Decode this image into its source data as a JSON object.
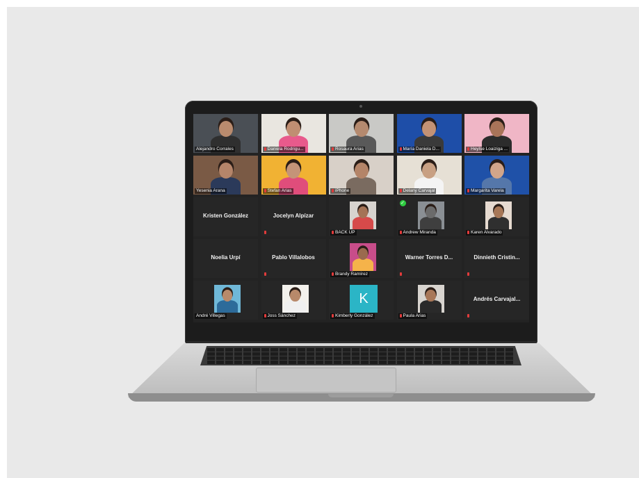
{
  "meeting": {
    "participants": [
      {
        "name": "Alejandro Corrales",
        "type": "video",
        "photo_bg": "#4a4f55",
        "skin": "#b98b6e",
        "clothes": "#2f2f2f",
        "muted": false
      },
      {
        "name": "Daniela Rodrigu...",
        "type": "video",
        "photo_bg": "#e9e6e0",
        "skin": "#c08e72",
        "clothes": "#e85a8c",
        "muted": true
      },
      {
        "name": "Rosaura Arias",
        "type": "video",
        "photo_bg": "#c9c9c6",
        "skin": "#b58a6f",
        "clothes": "#595959",
        "muted": true
      },
      {
        "name": "María Daniela D...",
        "type": "video",
        "photo_bg": "#1e4ea8",
        "skin": "#c39275",
        "clothes": "#3a3a3a",
        "muted": true
      },
      {
        "name": "Heylse Loaiziga ...",
        "type": "video",
        "photo_bg": "#f0b6c6",
        "skin": "#a97459",
        "clothes": "#2c2c2c",
        "muted": true
      },
      {
        "name": "Yesenia Arana",
        "type": "video",
        "photo_bg": "#7a5a45",
        "skin": "#b5856a",
        "clothes": "#2b3a5a",
        "muted": false
      },
      {
        "name": "Stefan Arias",
        "type": "video",
        "photo_bg": "#f1b233",
        "skin": "#c49478",
        "clothes": "#e04d7b",
        "muted": true
      },
      {
        "name": "iPhone",
        "type": "video",
        "photo_bg": "#d8d0c8",
        "skin": "#b48468",
        "clothes": "#7a6b60",
        "muted": true
      },
      {
        "name": "Delany Carvajal",
        "type": "video",
        "photo_bg": "#e6e0d5",
        "skin": "#c8a083",
        "clothes": "#f4f4f4",
        "muted": true
      },
      {
        "name": "Margarita Varela",
        "type": "video",
        "photo_bg": "#1f51a8",
        "skin": "#d1a58a",
        "clothes": "#5577aa",
        "muted": true
      },
      {
        "name": "Kristen González",
        "type": "name-only",
        "muted": false
      },
      {
        "name": "Jocelyn Alpízar",
        "type": "name-only",
        "muted": true
      },
      {
        "name": "BACK UP",
        "type": "small-photo",
        "photo_bg": "#d7d3cf",
        "skin": "#a47356",
        "clothes": "#d64a4a",
        "muted": true
      },
      {
        "name": "Andrew Miranda",
        "type": "small-photo",
        "photo_bg": "#8a8f94",
        "skin": "#6b6b6b",
        "clothes": "#3f3f3f",
        "muted": true,
        "checked": true
      },
      {
        "name": "Karen Alvarado",
        "type": "small-photo",
        "photo_bg": "#e6dad0",
        "skin": "#a77757",
        "clothes": "#2f2f2f",
        "muted": true
      },
      {
        "name": "Noelia Urpí",
        "type": "name-only",
        "muted": false
      },
      {
        "name": "Pablo Villalobos",
        "type": "name-only",
        "muted": true
      },
      {
        "name": "Brandy Ramírez",
        "type": "small-photo",
        "photo_bg": "#c84d8a",
        "skin": "#9a6a4e",
        "clothes": "#f5b34a",
        "muted": true
      },
      {
        "name": "Warner Torres D...",
        "type": "name-only",
        "muted": true
      },
      {
        "name": "Dinnieth Cristin...",
        "type": "name-only",
        "muted": true
      },
      {
        "name": "André Villegas",
        "type": "small-photo",
        "photo_bg": "#6fb8d8",
        "skin": "#b88a6b",
        "clothes": "#2d6b9a",
        "muted": false
      },
      {
        "name": "Joss Sánchez",
        "type": "small-photo",
        "photo_bg": "#f3f1ec",
        "skin": "#b8896a",
        "clothes": "#f0f0f0",
        "muted": true
      },
      {
        "name": "Kimberly González",
        "type": "initial",
        "initial": "K",
        "muted": true
      },
      {
        "name": "Paula Arias",
        "type": "small-photo",
        "photo_bg": "#d8d4cf",
        "skin": "#a87758",
        "clothes": "#2a2a2a",
        "muted": true
      },
      {
        "name": "Andrés Carvajal...",
        "type": "name-only",
        "muted": true
      }
    ]
  }
}
